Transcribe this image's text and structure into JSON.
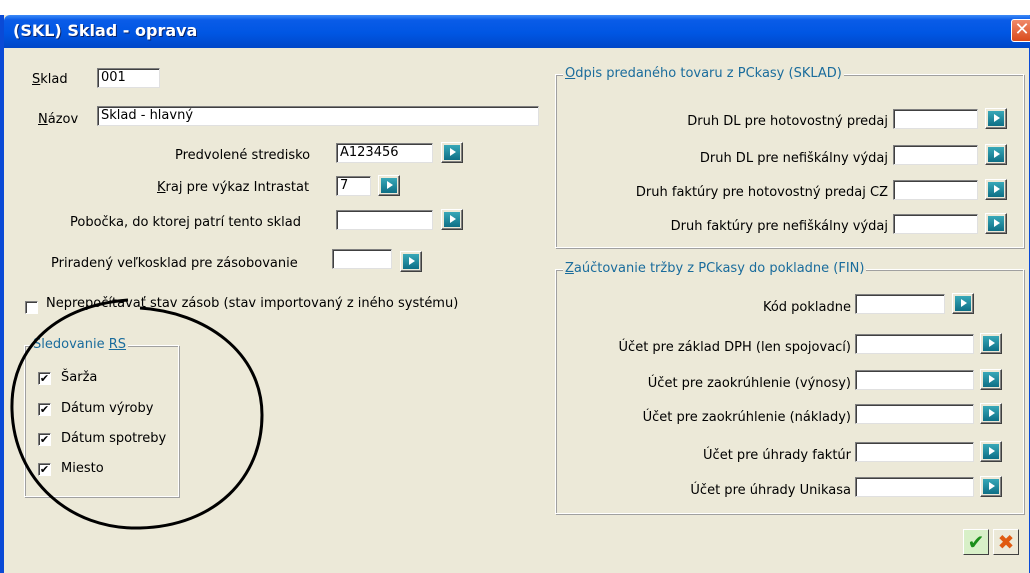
{
  "window": {
    "title": "(SKL) Sklad - oprava",
    "close_glyph": "✕"
  },
  "left": {
    "sklad": {
      "label_first": "S",
      "label_rest": "klad",
      "value": "001"
    },
    "nazov": {
      "label_first": "N",
      "label_rest": "ázov",
      "value": "Sklad - hlavný"
    },
    "stredisko": {
      "label": "Predvolené stredisko",
      "value": "A123456"
    },
    "kraj": {
      "label_first": "K",
      "label_rest": "raj pre výkaz Intrastat",
      "value": "7"
    },
    "pobocka": {
      "label": "Pobočka, do ktorej patrí tento sklad",
      "value": ""
    },
    "velkosklad": {
      "label": "Priradený veľkosklad pre zásobovanie",
      "value": ""
    },
    "neprepocitavat": {
      "label": "Neprepočítavať stav zásob (stav importovaný z iného systému)",
      "checked": false
    },
    "sledovanie": {
      "title_prefix": "Sledovanie ",
      "title_underlined": "RS",
      "items": [
        {
          "label": "Šarža",
          "checked": true
        },
        {
          "label": "Dátum výroby",
          "checked": true
        },
        {
          "label": "Dátum spotreby",
          "checked": true
        },
        {
          "label": "Miesto",
          "checked": true
        }
      ]
    }
  },
  "odpis": {
    "title_first": "O",
    "title_rest": "dpis predaného tovaru z PCkasy (SKLAD)",
    "fields": [
      {
        "label": "Druh DL pre hotovostný predaj",
        "value": ""
      },
      {
        "label": "Druh DL pre nefiškálny výdaj",
        "value": ""
      },
      {
        "label": "Druh faktúry pre hotovostný predaj CZ",
        "value": ""
      },
      {
        "label": "Druh faktúry pre nefiškálny výdaj",
        "value": ""
      }
    ]
  },
  "zauctovanie": {
    "title_first": "Z",
    "title_rest": "aúčtovanie tržby z PCkasy do pokladne (FIN)",
    "fields": [
      {
        "label": "Kód pokladne",
        "value": ""
      },
      {
        "label": "Účet pre základ DPH (len spojovací)",
        "value": ""
      },
      {
        "label": "Účet pre zaokrúhlenie (výnosy)",
        "value": ""
      },
      {
        "label": "Účet pre zaokrúhlenie (náklady)",
        "value": ""
      },
      {
        "label": "Účet pre úhrady faktúr",
        "value": ""
      },
      {
        "label": "Účet pre úhrady Unikasa",
        "value": ""
      }
    ]
  },
  "buttons": {
    "ok_glyph": "✔",
    "cancel_glyph": "✖"
  },
  "check_glyph": "✔"
}
